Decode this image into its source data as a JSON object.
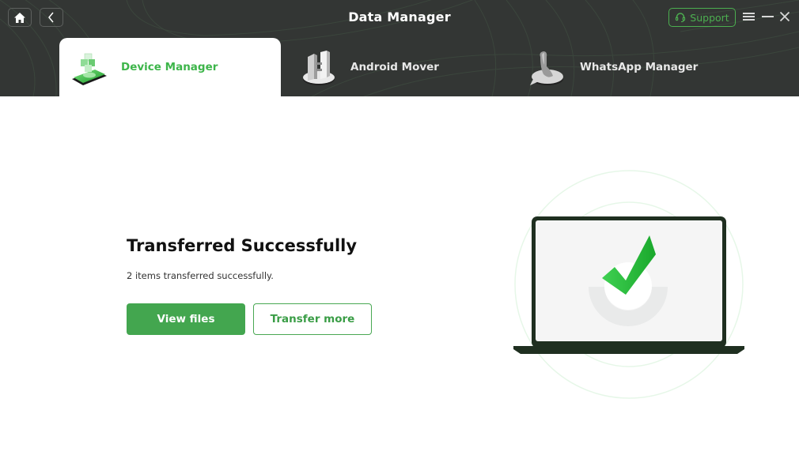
{
  "window": {
    "title": "Data Manager",
    "support_label": "Support"
  },
  "icons": {
    "home": "home-icon",
    "back": "chevron-left-icon",
    "support": "headset-icon",
    "menu": "hamburger-menu-icon",
    "minimize": "minimize-icon",
    "close": "close-icon"
  },
  "tabs": [
    {
      "label": "Device Manager",
      "icon": "device-manager-icon",
      "active": true
    },
    {
      "label": "Android Mover",
      "icon": "android-mover-icon",
      "active": false
    },
    {
      "label": "WhatsApp Manager",
      "icon": "whatsapp-manager-icon",
      "active": false
    }
  ],
  "result": {
    "title": "Transferred Successfully",
    "description": "2 items transferred successfully.",
    "primary_button": "View files",
    "secondary_button": "Transfer more",
    "illustration": "laptop-checkmark-illustration"
  },
  "colors": {
    "header_bg": "#333634",
    "accent_green": "#43a64f",
    "tab_active_text": "#3db54a",
    "laptop_frame": "#1f2f20"
  }
}
